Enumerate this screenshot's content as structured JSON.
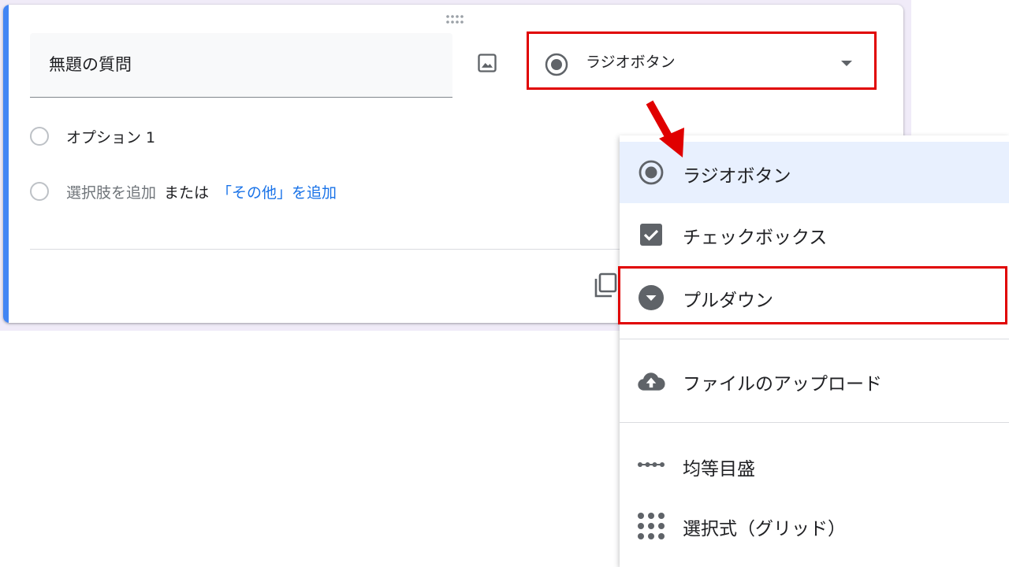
{
  "question": {
    "title": "無題の質問",
    "type_selected": "ラジオボタン",
    "options": [
      {
        "label": "オプション 1"
      }
    ],
    "add_choice": "選択肢を追加",
    "add_or": "または",
    "add_other": "「その他」を追加"
  },
  "menu": {
    "items": [
      {
        "label": "ラジオボタン",
        "icon": "radio-checked-icon",
        "selected": true
      },
      {
        "label": "チェックボックス",
        "icon": "checkbox-icon",
        "selected": false
      },
      {
        "label": "プルダウン",
        "icon": "dropdown-circle-icon",
        "selected": false
      },
      {
        "label": "ファイルのアップロード",
        "icon": "cloud-upload-icon",
        "selected": false
      },
      {
        "label": "均等目盛",
        "icon": "linear-scale-icon",
        "selected": false
      },
      {
        "label": "選択式（グリッド）",
        "icon": "grid-icon",
        "selected": false
      }
    ]
  },
  "colors": {
    "accent": "#4285f4",
    "link": "#1a73e8",
    "highlight": "#e00000",
    "selected_bg": "#e8f0fe",
    "icon": "#5f6368"
  }
}
